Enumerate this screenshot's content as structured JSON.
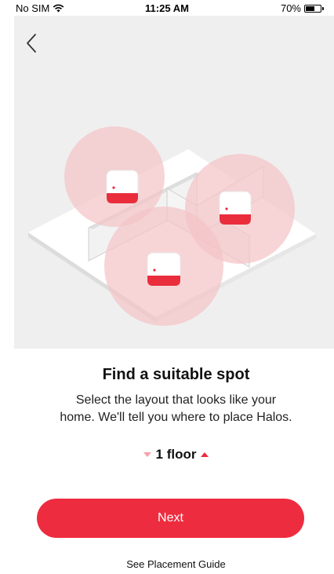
{
  "status_bar": {
    "carrier": "No SIM",
    "time": "11:25 AM",
    "battery_percent": "70%",
    "battery_level": 0.7,
    "wifi_icon": "wifi-icon"
  },
  "nav": {
    "back_icon": "chevron-left-icon"
  },
  "content": {
    "title": "Find a suitable spot",
    "description_line1": "Select the layout that looks like your",
    "description_line2": "home. We'll tell you where to place Halos.",
    "floor_label": "1 floor"
  },
  "actions": {
    "next_label": "Next",
    "guide_label": "See Placement Guide"
  },
  "colors": {
    "accent": "#ee2c3f",
    "hero_bg": "#efefef",
    "coverage": "#f4c4c6"
  }
}
